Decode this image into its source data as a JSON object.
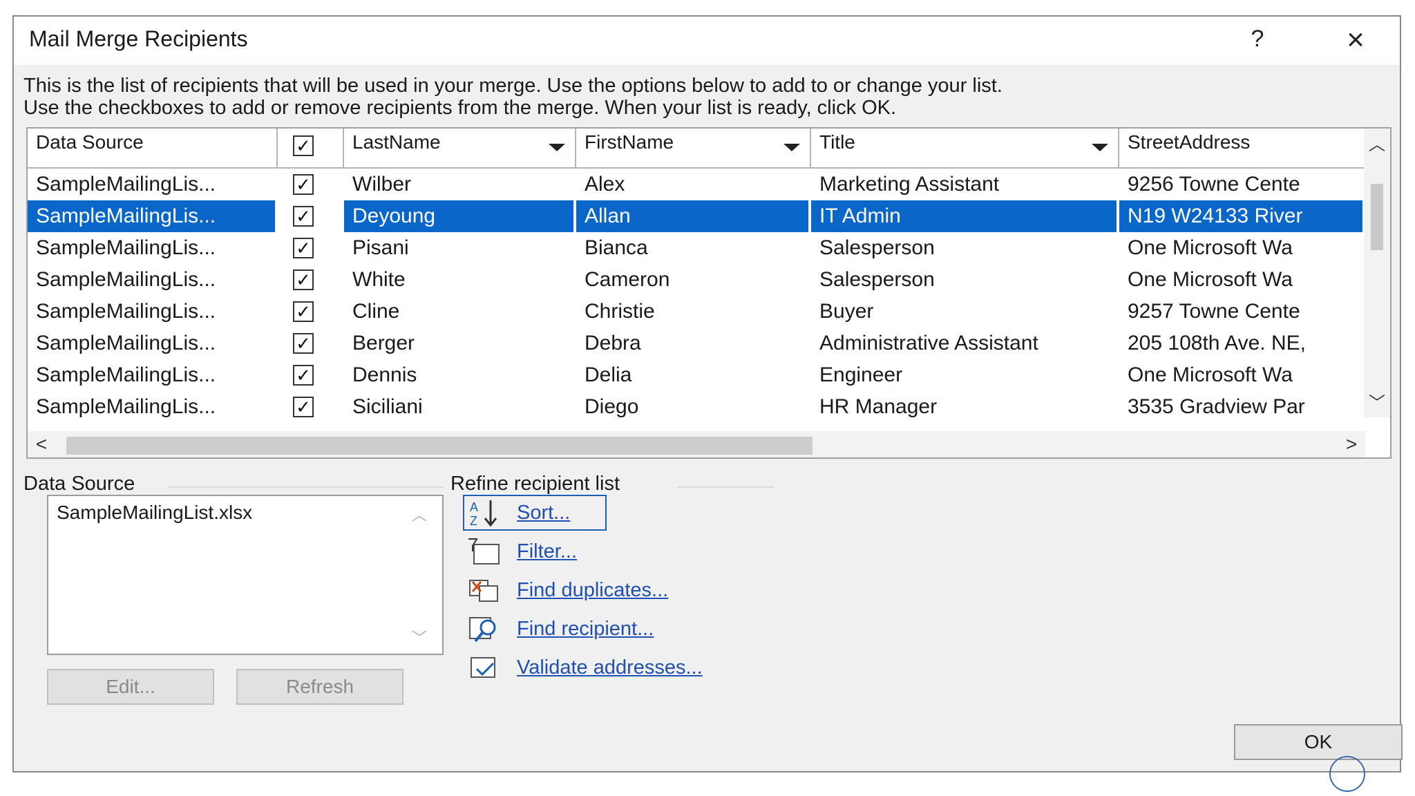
{
  "window": {
    "title": "Mail Merge Recipients",
    "help_label": "?",
    "close_label": "×"
  },
  "intro": {
    "line1": "This is the list of recipients that will be used in your merge.  Use the options below to add to or change your list.",
    "line2": "Use the checkboxes to add or remove recipients from the merge.  When your list is ready, click OK."
  },
  "grid": {
    "columns": {
      "data_source": "Data Source",
      "last_name": "LastName",
      "first_name": "FirstName",
      "title": "Title",
      "street_address": "StreetAddress"
    },
    "rows": [
      {
        "source": "SampleMailingLis...",
        "checked": true,
        "last": "Wilber",
        "first": "Alex",
        "title": "Marketing Assistant",
        "street": "9256 Towne Cente",
        "selected": false
      },
      {
        "source": "SampleMailingLis...",
        "checked": true,
        "last": "Deyoung",
        "first": "Allan",
        "title": "IT Admin",
        "street": "N19 W24133 River",
        "selected": true
      },
      {
        "source": "SampleMailingLis...",
        "checked": true,
        "last": "Pisani",
        "first": "Bianca",
        "title": "Salesperson",
        "street": "One Microsoft Wa",
        "selected": false
      },
      {
        "source": "SampleMailingLis...",
        "checked": true,
        "last": "White",
        "first": "Cameron",
        "title": "Salesperson",
        "street": "One Microsoft Wa",
        "selected": false
      },
      {
        "source": "SampleMailingLis...",
        "checked": true,
        "last": "Cline",
        "first": "Christie",
        "title": "Buyer",
        "street": "9257 Towne Cente",
        "selected": false
      },
      {
        "source": "SampleMailingLis...",
        "checked": true,
        "last": "Berger",
        "first": "Debra",
        "title": "Administrative Assistant",
        "street": "205 108th Ave. NE,",
        "selected": false
      },
      {
        "source": "SampleMailingLis...",
        "checked": true,
        "last": "Dennis",
        "first": "Delia",
        "title": "Engineer",
        "street": "One Microsoft Wa",
        "selected": false
      },
      {
        "source": "SampleMailingLis...",
        "checked": true,
        "last": "Siciliani",
        "first": "Diego",
        "title": "HR Manager",
        "street": "3535 Gradview Par",
        "selected": false
      }
    ]
  },
  "data_source_group": {
    "label": "Data Source",
    "items": [
      "SampleMailingList.xlsx"
    ],
    "edit_label": "Edit...",
    "refresh_label": "Refresh"
  },
  "refine": {
    "label": "Refine recipient list",
    "sort": "Sort...",
    "filter": "Filter...",
    "find_duplicates": "Find duplicates...",
    "find_recipient": "Find recipient...",
    "validate_addresses": "Validate addresses..."
  },
  "ok_label": "OK",
  "colors": {
    "selection": "#0a66c8",
    "link": "#1f4fb0",
    "dialog_bg": "#f0f0f0"
  }
}
